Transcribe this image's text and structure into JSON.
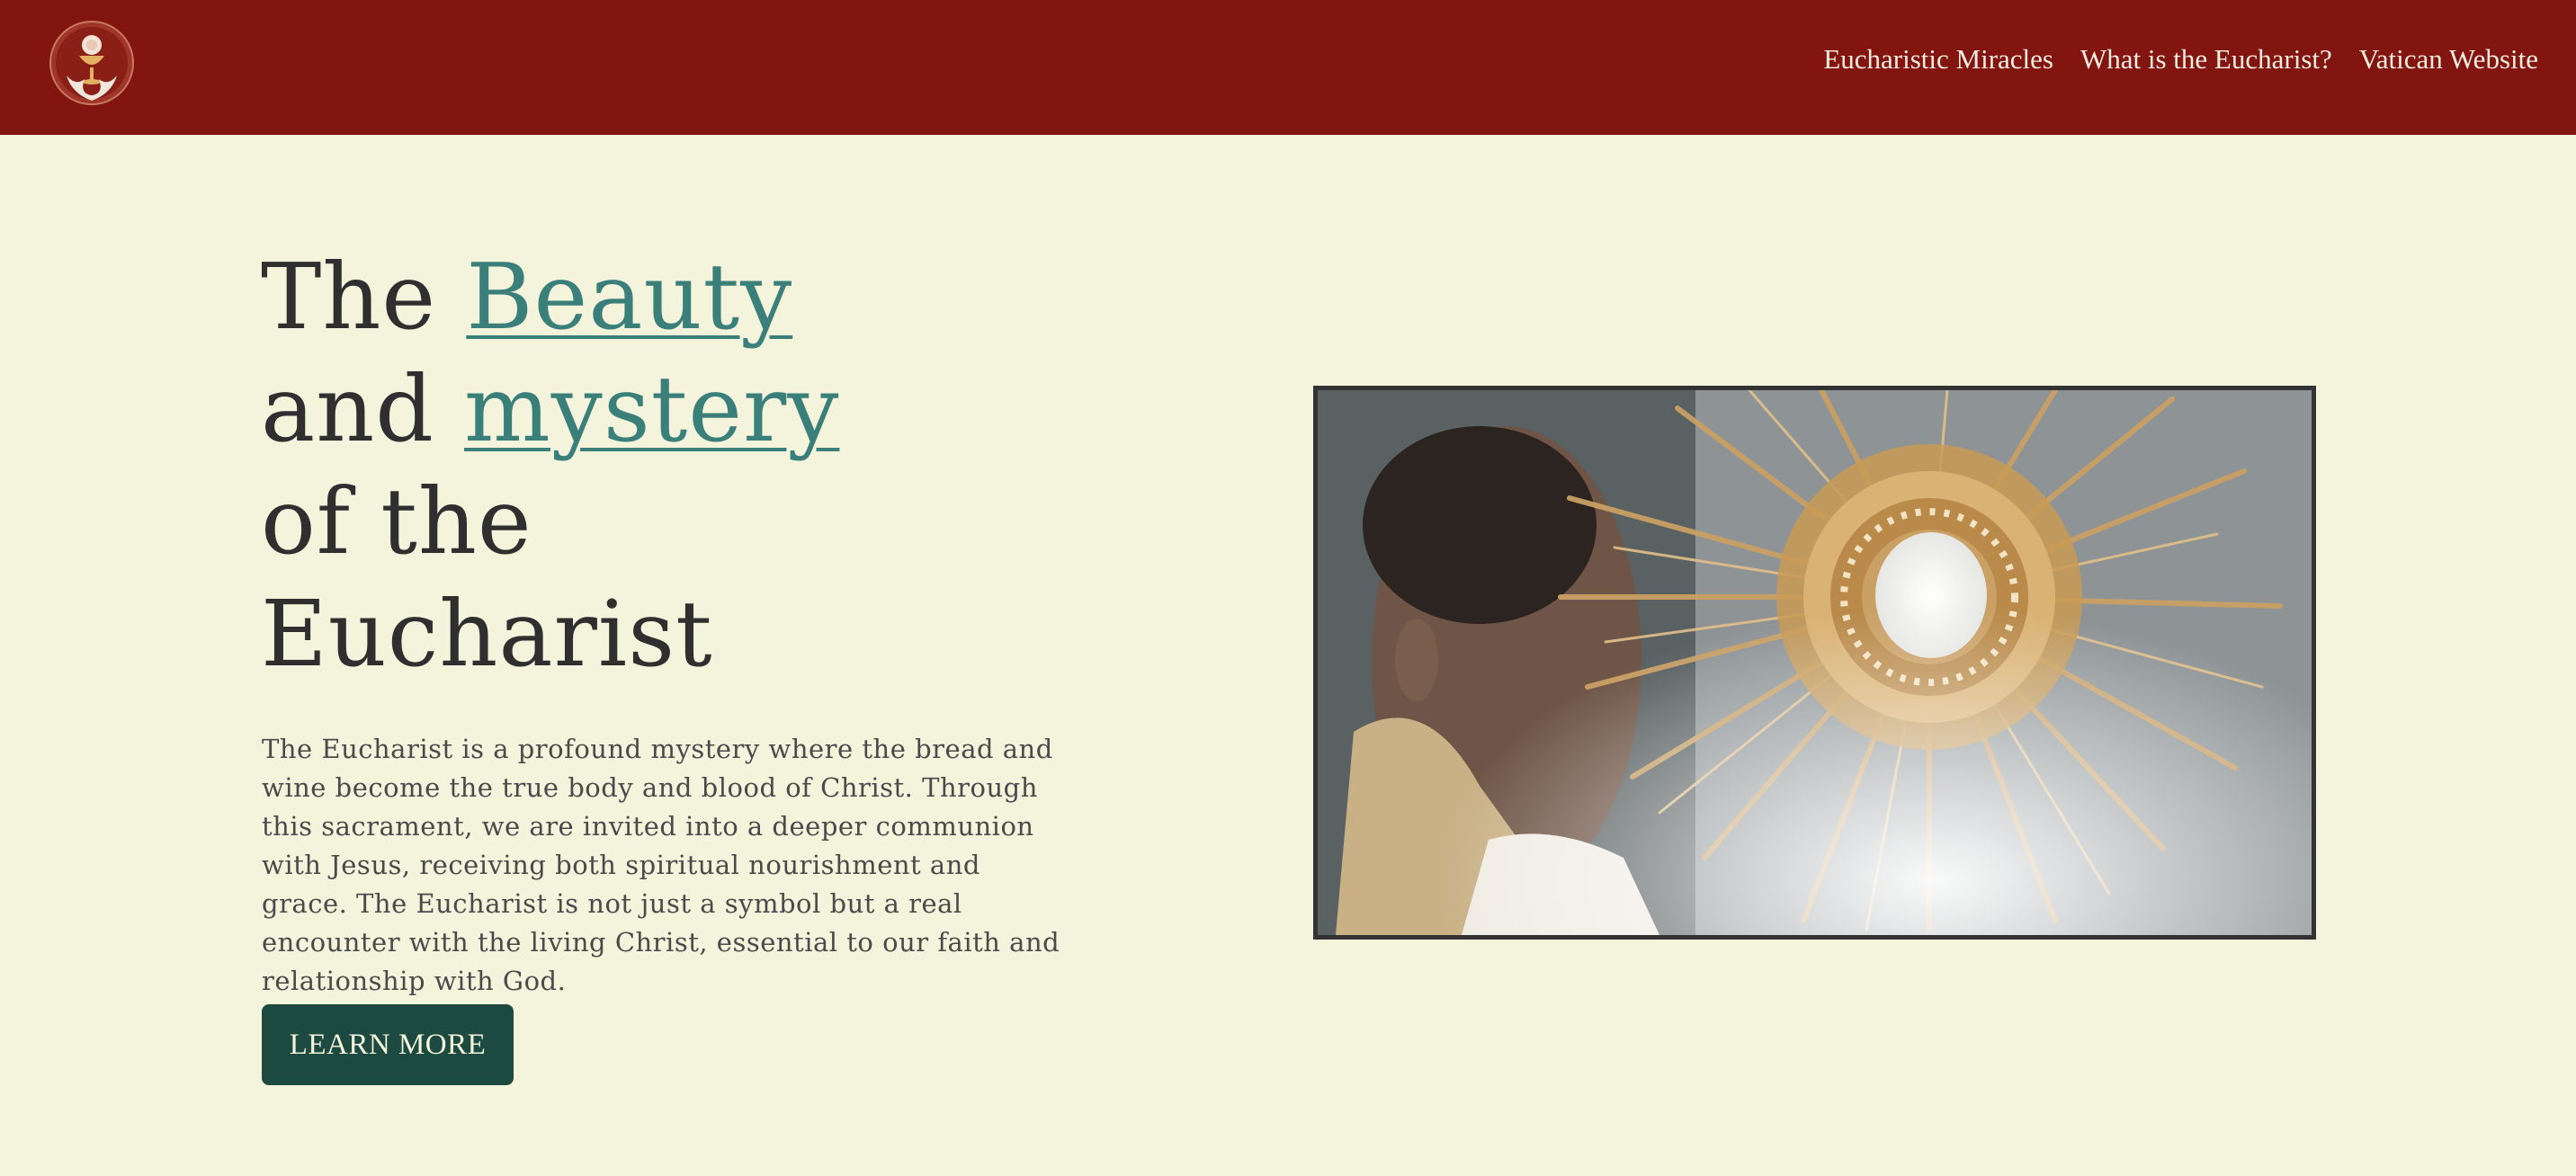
{
  "nav": {
    "logo_icon": "chalice-host-emblem",
    "links": [
      {
        "label": "Eucharistic Miracles"
      },
      {
        "label": "What is the Eucharist?"
      },
      {
        "label": "Vatican Website"
      }
    ]
  },
  "hero": {
    "title": {
      "part1": "The ",
      "beauty": "Beauty",
      "part2": "and ",
      "mystery": "mystery",
      "part3": "of the",
      "part4": "Eucharist"
    },
    "description": "The Eucharist is a profound mystery where the bread and wine become the true body and blood of Christ. Through this sacrament, we are invited into a deeper communion with Jesus, receiving both spiritual nourishment and grace. The Eucharist is not just a symbol but a real encounter with the living Christ, essential to our faith and relationship with God.",
    "cta_label": "LEARN MORE"
  },
  "image": {
    "subject": "priest-holding-golden-monstrance"
  },
  "colors": {
    "nav_bg": "#82150f",
    "page_bg": "#f4f3dc",
    "accent": "#3a7f79",
    "button_bg": "#1d4a40"
  }
}
